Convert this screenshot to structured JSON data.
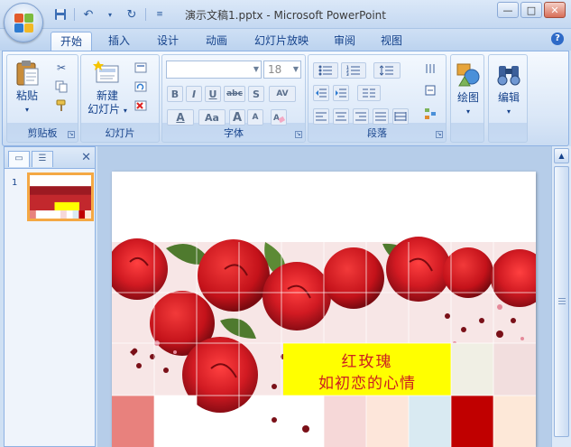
{
  "window": {
    "title": "演示文稿1.pptx - Microsoft PowerPoint",
    "controls": [
      "—",
      "□",
      "✕"
    ]
  },
  "qat": {
    "save_icon": "save-icon",
    "undo_icon": "undo-icon",
    "redo_icon": "redo-icon"
  },
  "tabs": [
    "开始",
    "插入",
    "设计",
    "动画",
    "幻灯片放映",
    "审阅",
    "视图"
  ],
  "active_tab": "开始",
  "ribbon": {
    "groups": {
      "clipboard": {
        "label": "剪贴板",
        "paste_label": "粘贴"
      },
      "slides": {
        "label": "幻灯片",
        "new_slide_line1": "新建",
        "new_slide_line2": "幻灯片"
      },
      "font": {
        "label": "字体",
        "font_size": "18",
        "bold": "B",
        "italic": "I",
        "underline": "U",
        "strike": "abc",
        "shadow": "S",
        "spacing": "AV",
        "font_color": "A",
        "change_case": "Aa",
        "grow": "A",
        "shrink": "A"
      },
      "paragraph": {
        "label": "段落"
      },
      "drawing": {
        "label": "绘图"
      },
      "editing": {
        "label": "编辑"
      }
    }
  },
  "pane": {
    "slide_number": "1"
  },
  "slide": {
    "text_line1": "红玫瑰",
    "text_line2": "如初恋的心情",
    "text_color": "#cc2020",
    "box_color": "#ffff00"
  }
}
